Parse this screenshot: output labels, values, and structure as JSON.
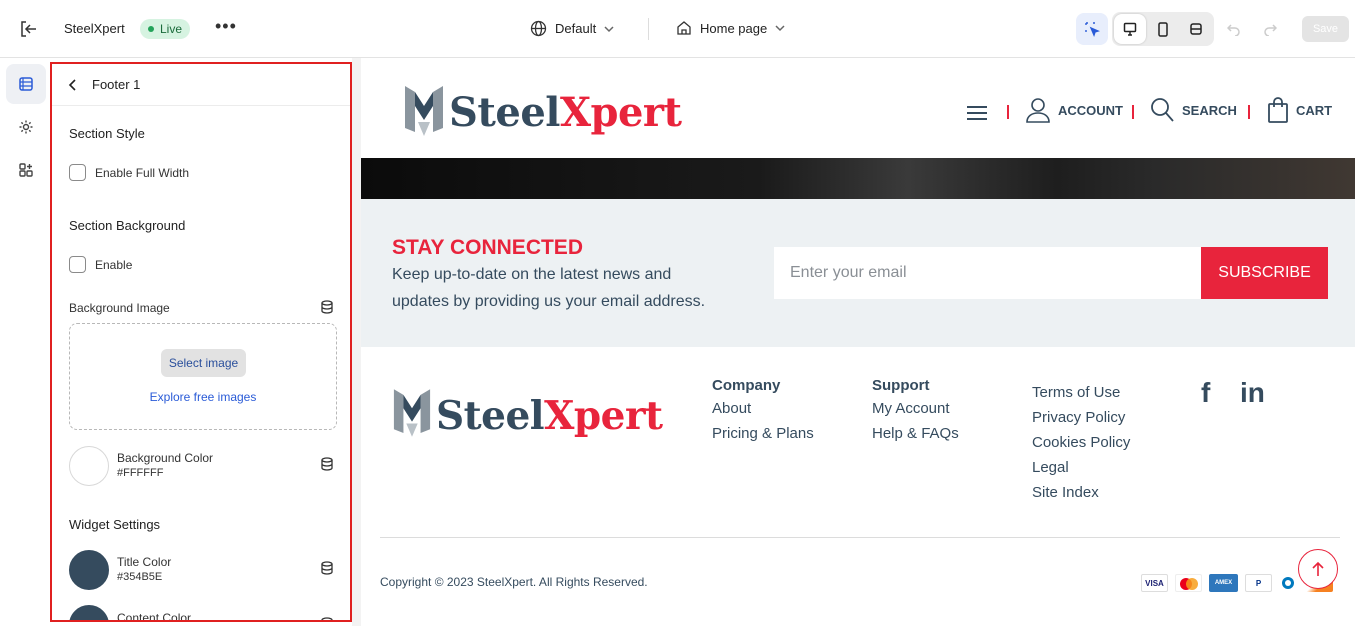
{
  "topbar": {
    "store_name": "SteelXpert",
    "status_badge": "Live",
    "more_label": "•••",
    "theme_select": "Default",
    "page_select": "Home page",
    "save_label": "Save"
  },
  "panel": {
    "title": "Footer 1",
    "section_style": "Section Style",
    "enable_full_width": "Enable Full Width",
    "section_background": "Section Background",
    "enable": "Enable",
    "background_image": "Background Image",
    "select_image": "Select image",
    "explore_free_images": "Explore free images",
    "background_color_label": "Background Color",
    "background_color_value": "#FFFFFF",
    "widget_settings": "Widget Settings",
    "title_color_label": "Title Color",
    "title_color_value": "#354B5E",
    "content_color_label": "Content Color"
  },
  "preview": {
    "logo_part1": "Steel",
    "logo_part2": "Xpert",
    "nav": {
      "account": "ACCOUNT",
      "search": "SEARCH",
      "cart": "CART"
    },
    "newsletter": {
      "title": "STAY CONNECTED",
      "text": "Keep up-to-date on the latest news and updates by providing us your email address.",
      "placeholder": "Enter your email",
      "button": "SUBSCRIBE"
    },
    "footer": {
      "company_heading": "Company",
      "company_links": [
        "About",
        "Pricing & Plans"
      ],
      "support_heading": "Support",
      "support_links": [
        "My Account",
        "Help & FAQs"
      ],
      "legal_links": [
        "Terms of Use",
        "Privacy Policy",
        "Cookies Policy",
        "Legal",
        "Site Index"
      ],
      "social_facebook": "f",
      "social_linkedin": "in",
      "copyright": "Copyright © 2023 SteelXpert. All Rights Reserved.",
      "payments": [
        "VISA",
        "AMEX",
        "P"
      ]
    }
  },
  "colors": {
    "brand_red": "#E8243C",
    "brand_navy": "#354B5E",
    "selection_outline": "#E02020"
  }
}
